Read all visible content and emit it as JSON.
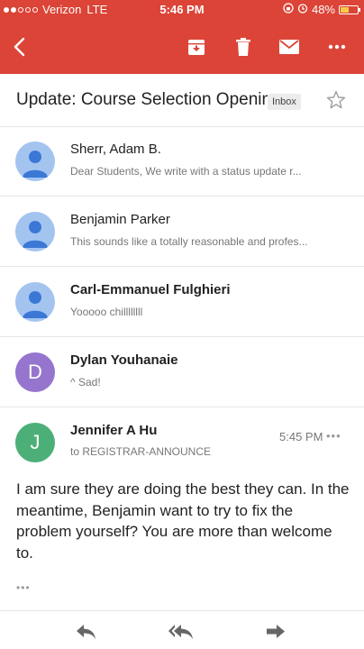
{
  "status_bar": {
    "carrier": "Verizon",
    "network": "LTE",
    "time": "5:46 PM",
    "battery": "48%",
    "battery_level": 0.48
  },
  "toolbar": {
    "icons": [
      "back-arrow-icon",
      "archive-icon",
      "trash-icon",
      "mail-icon",
      "more-options-icon"
    ]
  },
  "subject": {
    "title": "Update: Course Selection Opening",
    "label": "Inbox"
  },
  "threads": [
    {
      "sender": "Sherr, Adam B.",
      "snippet": "Dear Students, We write with a status update r...",
      "avatar": "person-icon",
      "unread": false
    },
    {
      "sender": "Benjamin Parker",
      "snippet": "This sounds like a totally reasonable and profes...",
      "avatar": "person-icon",
      "unread": false
    },
    {
      "sender": "Carl-Emmanuel Fulghieri",
      "snippet": "Yooooo chillllllll",
      "avatar": "person-icon",
      "unread": true
    },
    {
      "sender": "Dylan Youhanaie",
      "snippet": "^ Sad!",
      "avatar_letter": "D",
      "avatar_color": "#9575cd",
      "unread": true
    }
  ],
  "open_message": {
    "sender": "Jennifer A Hu",
    "avatar_letter": "J",
    "avatar_color": "#4caf78",
    "time": "5:45 PM",
    "to": "to REGISTRAR-ANNOUNCE",
    "body": "I am sure they are doing the best they can. In the meantime, Benjamin want to try to fix the problem yourself? You are more than welcome to.",
    "trimmed": "•••"
  },
  "bottom_actions": [
    "reply-icon",
    "reply-all-icon",
    "forward-icon"
  ],
  "colors": {
    "header": "#db4437",
    "person_avatar": "#a4c4f0",
    "person_glyph": "#3b78d6"
  }
}
